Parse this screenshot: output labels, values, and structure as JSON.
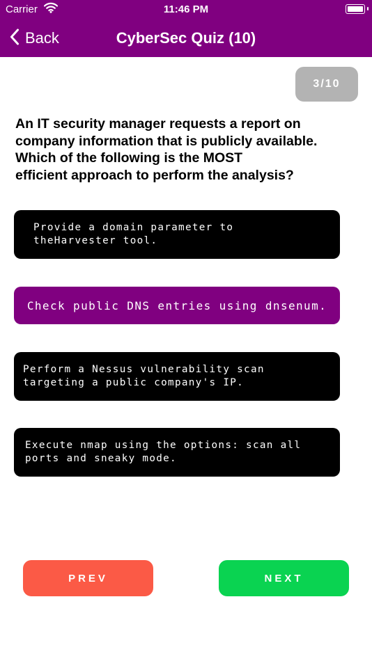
{
  "status_bar": {
    "carrier": "Carrier",
    "time": "11:46 PM"
  },
  "nav": {
    "back_label": "Back",
    "title": "CyberSec Quiz (10)"
  },
  "progress": {
    "label": "3/10",
    "current": 3,
    "total": 10
  },
  "question": {
    "text": "An IT security manager requests a report on\ncompany information that is publicly available.\n        Which of the following is the MOST\nefficient approach to perform the analysis?"
  },
  "options": [
    {
      "text": "Provide a domain parameter to theHarvester tool.",
      "selected": false
    },
    {
      "text": "Check public DNS entries using dnsenum.",
      "selected": true
    },
    {
      "text": "Perform a Nessus vulnerability scan targeting a public company's IP.",
      "selected": false
    },
    {
      "text": "Execute nmap using the options: scan all ports and sneaky mode.",
      "selected": false
    }
  ],
  "buttons": {
    "prev_label": "PREV",
    "next_label": "NEXT"
  },
  "colors": {
    "header": "#800080",
    "option_default": "#000000",
    "option_selected": "#800080",
    "prev_button": "#fb5a46",
    "next_button": "#0ad351",
    "progress_pill": "#b3b3b3"
  }
}
